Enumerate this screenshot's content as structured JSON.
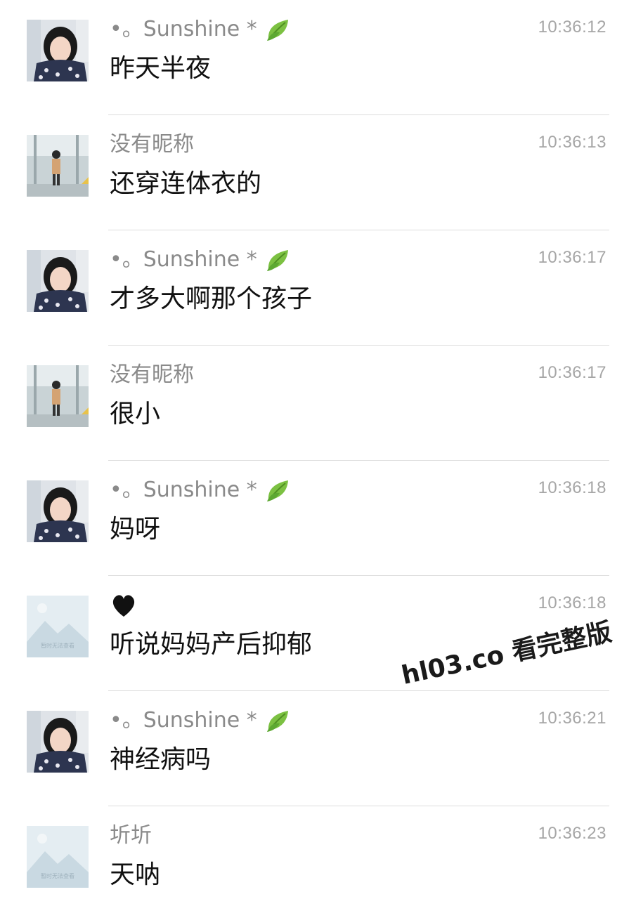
{
  "messages": [
    {
      "avatar": "girl-photo",
      "sender": "•。Sunshine *",
      "badge": "leaf",
      "time": "10:36:12",
      "text": "昨天半夜"
    },
    {
      "avatar": "child-photo",
      "sender": "没有昵称",
      "badge": "",
      "time": "10:36:13",
      "text": "还穿连体衣的"
    },
    {
      "avatar": "girl-photo",
      "sender": "•。Sunshine *",
      "badge": "leaf",
      "time": "10:36:17",
      "text": "才多大啊那个孩子"
    },
    {
      "avatar": "child-photo",
      "sender": "没有昵称",
      "badge": "",
      "time": "10:36:17",
      "text": "很小"
    },
    {
      "avatar": "girl-photo",
      "sender": "•。Sunshine *",
      "badge": "leaf",
      "time": "10:36:18",
      "text": "妈呀"
    },
    {
      "avatar": "placeholder-image",
      "sender": "",
      "badge": "black-heart",
      "time": "10:36:18",
      "text": "听说妈妈产后抑郁"
    },
    {
      "avatar": "girl-photo",
      "sender": "•。Sunshine *",
      "badge": "leaf",
      "time": "10:36:21",
      "text": "神经病吗"
    },
    {
      "avatar": "placeholder-image",
      "sender": "圻圻",
      "badge": "",
      "time": "10:36:23",
      "text": "天呐"
    }
  ],
  "placeholder_caption": "暂时无法查看",
  "watermark": "hl03.co 看完整版",
  "colors": {
    "sender": "#8a8a8a",
    "time": "#a6a6a6",
    "text": "#111111",
    "divider": "#dcdcdc"
  }
}
